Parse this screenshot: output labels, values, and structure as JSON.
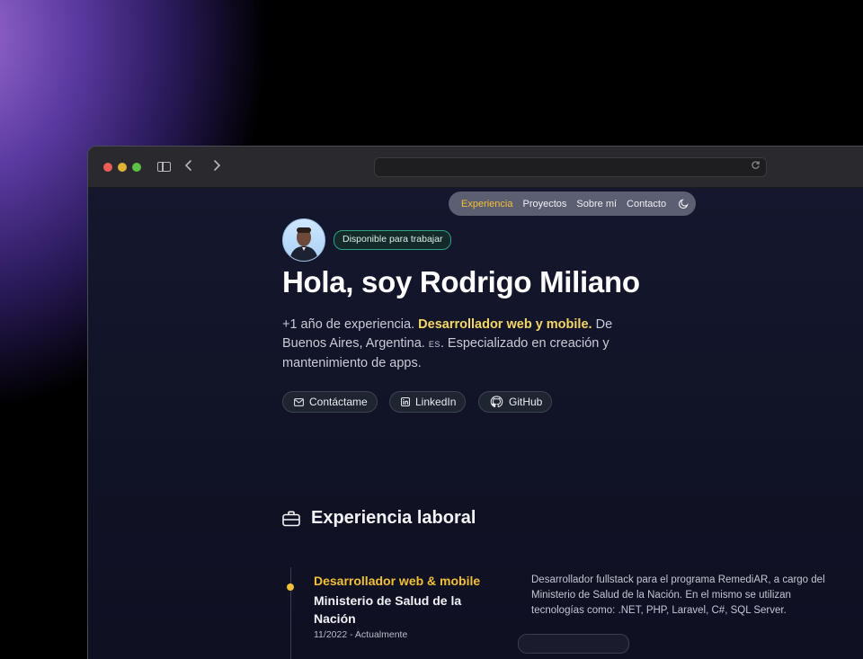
{
  "browser": {
    "url": ""
  },
  "nav": {
    "items": [
      {
        "label": "Experiencia",
        "active": true
      },
      {
        "label": "Proyectos",
        "active": false
      },
      {
        "label": "Sobre mí",
        "active": false
      },
      {
        "label": "Contacto",
        "active": false
      }
    ],
    "theme_icon": "moon-icon"
  },
  "hero": {
    "badge": "Disponible para trabajar",
    "title": "Hola, soy Rodrigo Miliano",
    "intro_part1": "+1 año de experiencia. ",
    "intro_highlight": "Desarrollador web y mobile.",
    "intro_part2": " De Buenos Aires, Argentina. ",
    "intro_flag": "ES",
    "intro_part3": ". Especializado en creación y mantenimiento de apps.",
    "buttons": {
      "contact": "Contáctame",
      "linkedin": "LinkedIn",
      "github": "GitHub"
    }
  },
  "experience": {
    "section_title": "Experiencia laboral",
    "jobs": [
      {
        "role": "Desarrollador web & mobile",
        "company": "Ministerio de Salud de la Nación",
        "date": "11/2022 - Actualmente",
        "description": "Desarrollador fullstack para el programa RemediAR, a cargo del Ministerio de Salud de la Nación. En el mismo se utilizan tecnologías como: .NET, PHP, Laravel, C#, SQL Server."
      }
    ]
  },
  "colors": {
    "accent": "#f2c037",
    "highlight": "#f5d766",
    "badge_border": "#2ea382"
  }
}
